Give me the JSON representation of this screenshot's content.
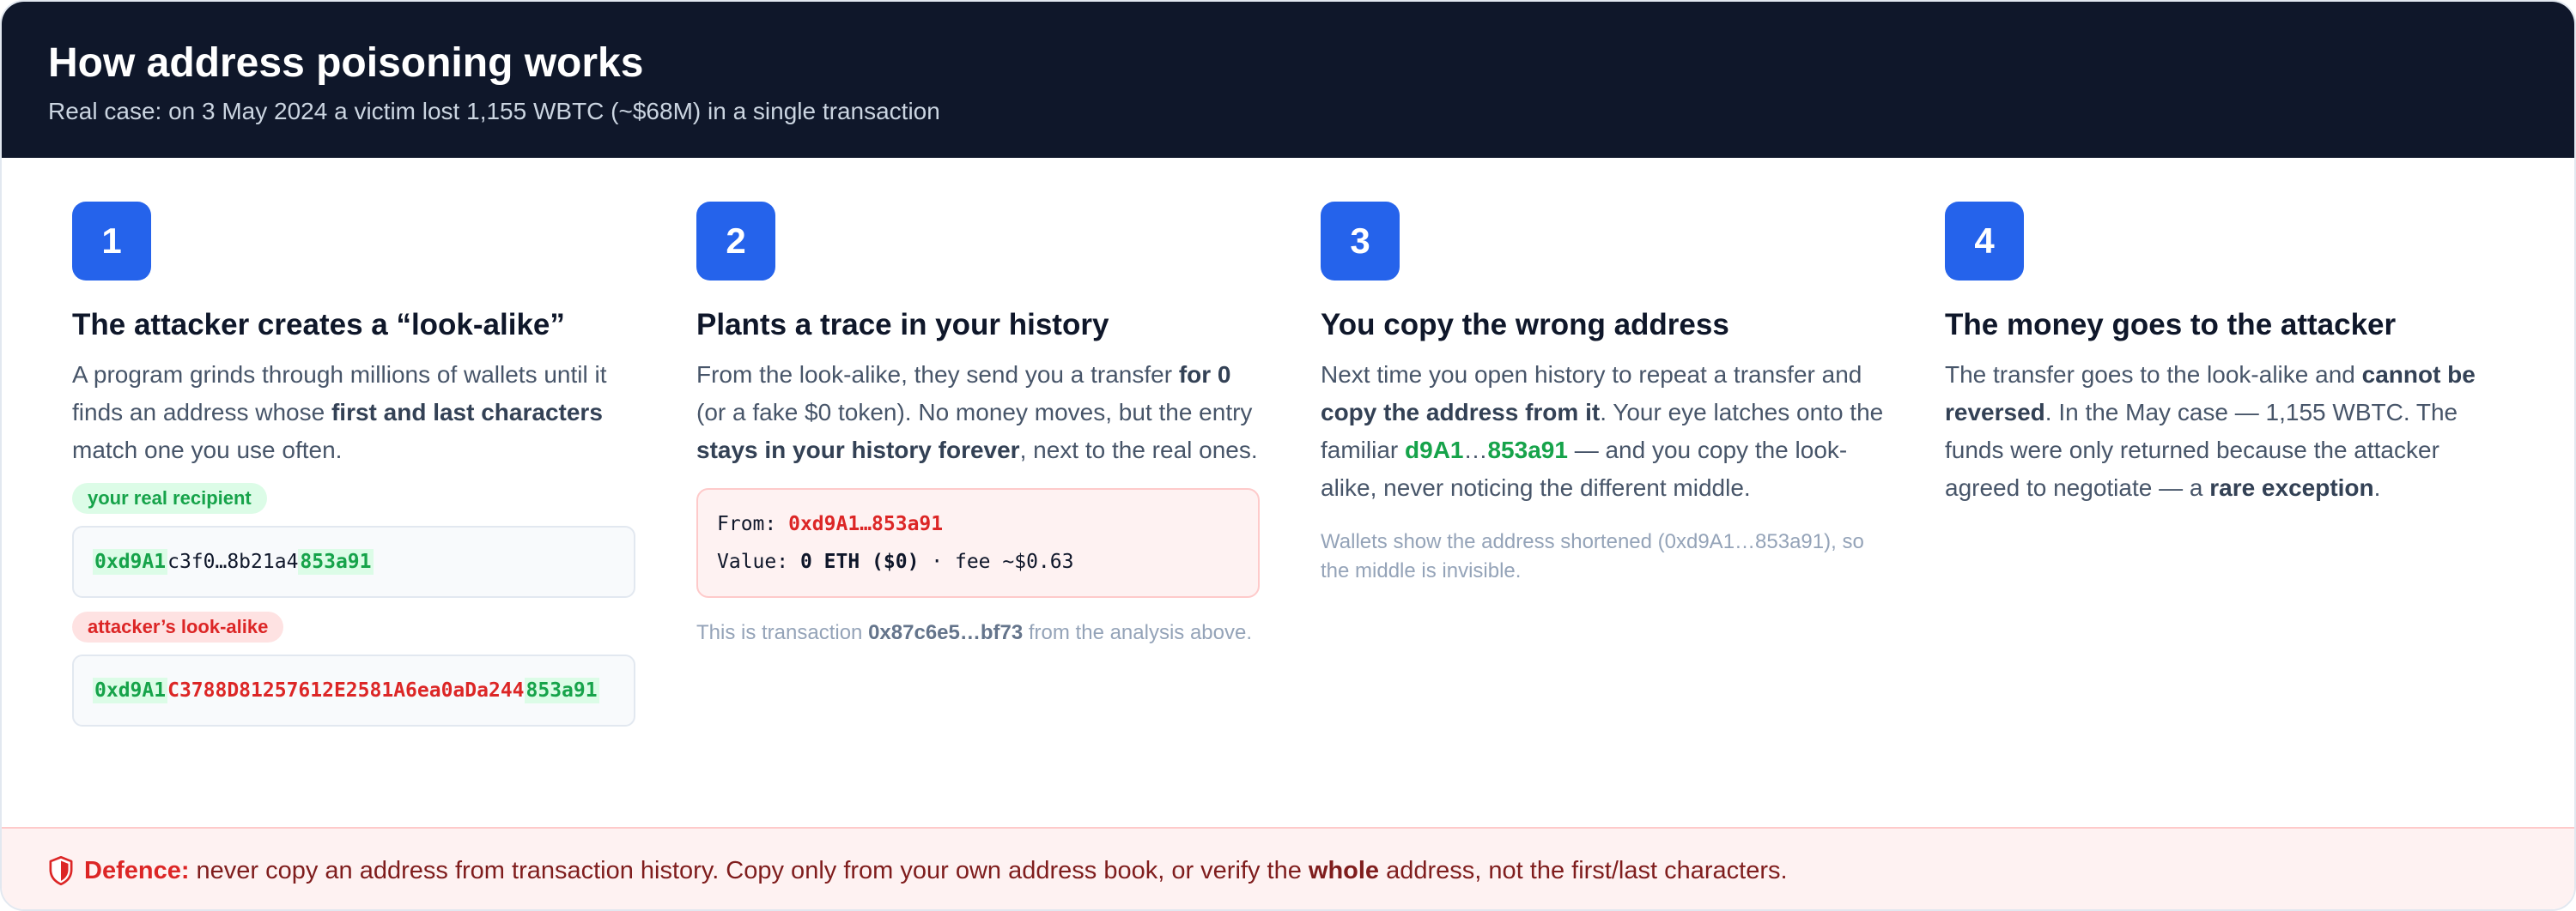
{
  "header": {
    "title": "How address poisoning works",
    "subtitle": "Real case: on 3 May 2024 a victim lost 1,155 WBTC (~$68M) in a single transaction"
  },
  "steps": [
    {
      "number": "1",
      "title": "The attacker creates a “look-alike”",
      "body": {
        "t1": "A program grinds through millions of wallets until it finds an address whose ",
        "b1": "first and last characters",
        "t2": " match one you use often."
      },
      "real_label": "your real recipient",
      "real_address": {
        "prefix": "0xd9A1",
        "middle": "c3f0…8b21a4",
        "suffix": "853a91"
      },
      "fake_label": "attacker’s look-alike",
      "fake_address": {
        "prefix": "0xd9A1",
        "middle": "C3788D81257612E2581A6ea0aDa244",
        "suffix": "853a91"
      }
    },
    {
      "number": "2",
      "title": "Plants a trace in your history",
      "body": {
        "t1": "From the look-alike, they send you a transfer ",
        "b1": "for 0",
        "t2": " (or a fake $0 token). No money moves, but the entry ",
        "b2": "stays in your history forever",
        "t3": ", next to the real ones."
      },
      "tx": {
        "from_label": "From:",
        "from_value": "0xd9A1…853a91",
        "value_label": "Value:",
        "value_amount": "0 ETH ($0)",
        "fee": "· fee ~$0.63"
      },
      "note": {
        "t1": "This is transaction ",
        "b1": "0x87c6e5…bf73",
        "t2": " from the analysis above."
      }
    },
    {
      "number": "3",
      "title": "You copy the wrong address",
      "body": {
        "t1": "Next time you open history to repeat a transfer and ",
        "b1": "copy the address from it",
        "t2": ". Your eye latches onto the familiar ",
        "g1": "d9A1",
        "t3": "…",
        "g2": "853a91",
        "t4": " — and you copy the look-alike, never noticing the different middle."
      },
      "note": "Wallets show the address shortened (0xd9A1…853a91), so the middle is invisible."
    },
    {
      "number": "4",
      "title": "The money goes to the attacker",
      "body": {
        "t1": "The transfer goes to the look-alike and ",
        "b1": "cannot be reversed",
        "t2": ". In the May case — 1,155 WBTC. The funds were only returned because the attacker agreed to negotiate — a ",
        "b2": "rare exception",
        "t3": "."
      }
    }
  ],
  "footer": {
    "icon": "shield-icon",
    "label": "Defence:",
    "t1": "never copy an address from transaction history. Copy only from your own address book, or verify the ",
    "b1": "whole",
    "t2": " address, not the first/last characters."
  },
  "colors": {
    "header_bg": "#0f172a",
    "accent": "#2563eb",
    "green": "#16a34a",
    "red": "#dc2626"
  }
}
